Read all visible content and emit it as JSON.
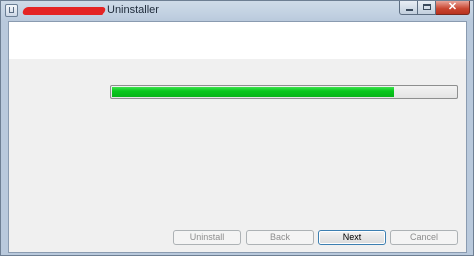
{
  "window": {
    "title": "Uninstaller",
    "controls": {
      "minimize_icon": "minimize-icon",
      "maximize_icon": "maximize-icon",
      "close_glyph": "✕"
    }
  },
  "progress": {
    "value_percent": 82
  },
  "buttons": {
    "uninstall": "Uninstall",
    "back": "Back",
    "next": "Next",
    "cancel": "Cancel"
  },
  "colors": {
    "progress_fill": "#06c219",
    "redaction": "#e42424"
  }
}
